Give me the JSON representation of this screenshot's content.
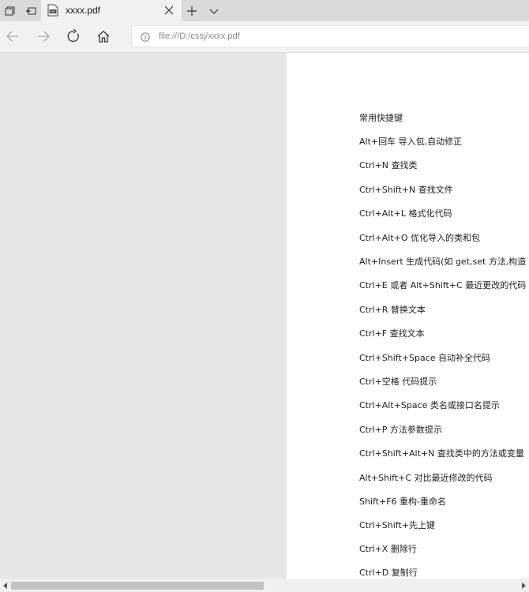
{
  "tab": {
    "title": "xxxx.pdf"
  },
  "address": {
    "url": "file:///D:/cssj/xxxx.pdf"
  },
  "document": {
    "lines": [
      "常用快捷键",
      "Alt+回车  导入包,自动修正",
      "Ctrl+N     查找类",
      "Ctrl+Shift+N  查找文件",
      "Ctrl+Alt+L  格式化代码",
      "Ctrl+Alt+O  优化导入的类和包",
      "Alt+Insert  生成代码(如 get,set 方法,构造",
      "Ctrl+E 或者 Alt+Shift+C   最近更改的代码",
      "Ctrl+R  替换文本",
      "Ctrl+F  查找文本",
      "Ctrl+Shift+Space  自动补全代码",
      "Ctrl+空格  代码提示",
      "Ctrl+Alt+Space  类名或接口名提示",
      "Ctrl+P  方法参数提示",
      "Ctrl+Shift+Alt+N  查找类中的方法或变量",
      "Alt+Shift+C  对比最近修改的代码",
      "Shift+F6   重构-重命名",
      "Ctrl+Shift+先上键",
      "Ctrl+X  删除行",
      "Ctrl+D  复制行"
    ]
  }
}
